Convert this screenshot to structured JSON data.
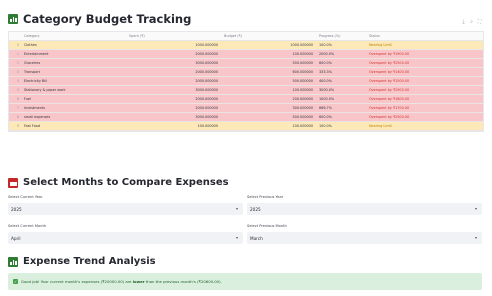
{
  "budget": {
    "title": "Category Budget Tracking",
    "columns": [
      "",
      "Category",
      "Spent (₹)",
      "Budget (₹)",
      "Progress (%)",
      "Status"
    ],
    "rows": [
      {
        "idx": "0",
        "category": "Clothes",
        "spent": "1000.000000",
        "budget": "1000.000000",
        "progress": "100.0%",
        "status": "Nearing Limit",
        "state": "near"
      },
      {
        "idx": "1",
        "category": "Entertainment",
        "spent": "2000.000000",
        "budget": "100.000000",
        "progress": "2000.0%",
        "status": "Overspent by ₹1900.00",
        "state": "over"
      },
      {
        "idx": "2",
        "category": "Groceries",
        "spent": "3000.000000",
        "budget": "500.000000",
        "progress": "600.0%",
        "status": "Overspent by ₹2500.00",
        "state": "over"
      },
      {
        "idx": "3",
        "category": "Transport",
        "spent": "2000.000000",
        "budget": "600.000000",
        "progress": "333.3%",
        "status": "Overspent by ₹1400.00",
        "state": "over"
      },
      {
        "idx": "4",
        "category": "Electricity Bill",
        "spent": "2000.000000",
        "budget": "500.000000",
        "progress": "400.0%",
        "status": "Overspent by ₹1500.00",
        "state": "over"
      },
      {
        "idx": "5",
        "category": "Stationary & paper work",
        "spent": "3000.000000",
        "budget": "100.000000",
        "progress": "3000.0%",
        "status": "Overspent by ₹2900.00",
        "state": "over"
      },
      {
        "idx": "6",
        "category": "Fuel",
        "spent": "2000.000000",
        "budget": "200.000000",
        "progress": "1000.0%",
        "status": "Overspent by ₹1800.00",
        "state": "over"
      },
      {
        "idx": "7",
        "category": "Investments",
        "spent": "2000.000000",
        "budget": "300.000000",
        "progress": "666.7%",
        "status": "Overspent by ₹1700.00",
        "state": "over"
      },
      {
        "idx": "8",
        "category": "small expenses",
        "spent": "3000.000000",
        "budget": "500.000000",
        "progress": "600.0%",
        "status": "Overspent by ₹2500.00",
        "state": "over"
      },
      {
        "idx": "9",
        "category": "Fast Food",
        "spent": "100.000000",
        "budget": "100.000000",
        "progress": "100.0%",
        "status": "Nearing Limit",
        "state": "near"
      }
    ]
  },
  "compare": {
    "title": "Select Months to Compare Expenses",
    "current_year_label": "Select Current Year",
    "current_year_value": "2025",
    "previous_year_label": "Select Previous Year",
    "previous_year_value": "2025",
    "current_month_label": "Select Current Month",
    "current_month_value": "April",
    "previous_month_label": "Select Previous Month",
    "previous_month_value": "March"
  },
  "trend": {
    "title": "Expense Trend Analysis",
    "msg_before": "Good job! Your current month's expenses (₹20000.00) are ",
    "msg_bold": "lower",
    "msg_after": " than the previous month's (₹20600.00)."
  },
  "colors": {
    "overspent_row": "#f8c6c9",
    "near_row": "#fde9b8",
    "success_bg": "#dbefdf",
    "icon_green": "#2e7d32",
    "icon_red": "#c62828"
  }
}
